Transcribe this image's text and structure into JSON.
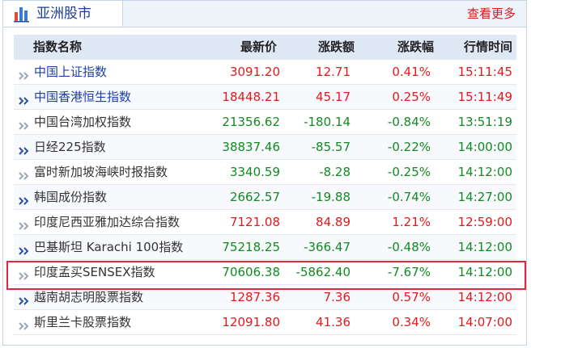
{
  "panel": {
    "title": "亚洲股市",
    "more_label": "查看更多"
  },
  "table": {
    "headers": [
      "指数名称",
      "最新价",
      "涨跌额",
      "涨跌幅",
      "行情时间"
    ],
    "rows": [
      {
        "name": "中国上证指数",
        "price": "3091.20",
        "change": "12.71",
        "pct": "0.41%",
        "time": "15:11:45",
        "direction": "up",
        "name_color": "blue"
      },
      {
        "name": "中国香港恒生指数",
        "price": "18448.21",
        "change": "45.17",
        "pct": "0.25%",
        "time": "15:11:49",
        "direction": "up",
        "name_color": "blue"
      },
      {
        "name": "中国台湾加权指数",
        "price": "21356.62",
        "change": "-180.14",
        "pct": "-0.84%",
        "time": "13:51:19",
        "direction": "down",
        "name_color": "dark"
      },
      {
        "name": "日经225指数",
        "price": "38837.46",
        "change": "-85.57",
        "pct": "-0.22%",
        "time": "14:00:00",
        "direction": "down",
        "name_color": "dark"
      },
      {
        "name": "富时新加坡海峡时报指数",
        "price": "3340.59",
        "change": "-8.28",
        "pct": "-0.25%",
        "time": "14:12:00",
        "direction": "down",
        "name_color": "dark"
      },
      {
        "name": "韩国成份指数",
        "price": "2662.57",
        "change": "-19.88",
        "pct": "-0.74%",
        "time": "14:27:00",
        "direction": "down",
        "name_color": "dark"
      },
      {
        "name": "印度尼西亚雅加达综合指数",
        "price": "7121.08",
        "change": "84.89",
        "pct": "1.21%",
        "time": "12:59:00",
        "direction": "up",
        "name_color": "dark"
      },
      {
        "name": "巴基斯坦 Karachi 100指数",
        "price": "75218.25",
        "change": "-366.47",
        "pct": "-0.48%",
        "time": "14:12:00",
        "direction": "down",
        "name_color": "dark"
      },
      {
        "name": "印度孟买SENSEX指数",
        "price": "70606.38",
        "change": "-5862.40",
        "pct": "-7.67%",
        "time": "14:12:00",
        "direction": "down",
        "name_color": "dark"
      },
      {
        "name": "越南胡志明股票指数",
        "price": "1287.36",
        "change": "7.36",
        "pct": "0.57%",
        "time": "14:12:00",
        "direction": "up",
        "name_color": "dark"
      },
      {
        "name": "斯里兰卡股票指数",
        "price": "12091.80",
        "change": "41.36",
        "pct": "0.34%",
        "time": "14:07:00",
        "direction": "up",
        "name_color": "dark"
      }
    ],
    "highlighted_row": 8
  },
  "colors": {
    "up": "#e4191b",
    "down": "#138a23",
    "link_blue": "#1f3fa8",
    "header_bg": "#dfe9f5",
    "highlight_border": "#e0283a"
  },
  "icons": {
    "panel": "bar-chart-icon",
    "row": "double-chevron-right-icon"
  }
}
